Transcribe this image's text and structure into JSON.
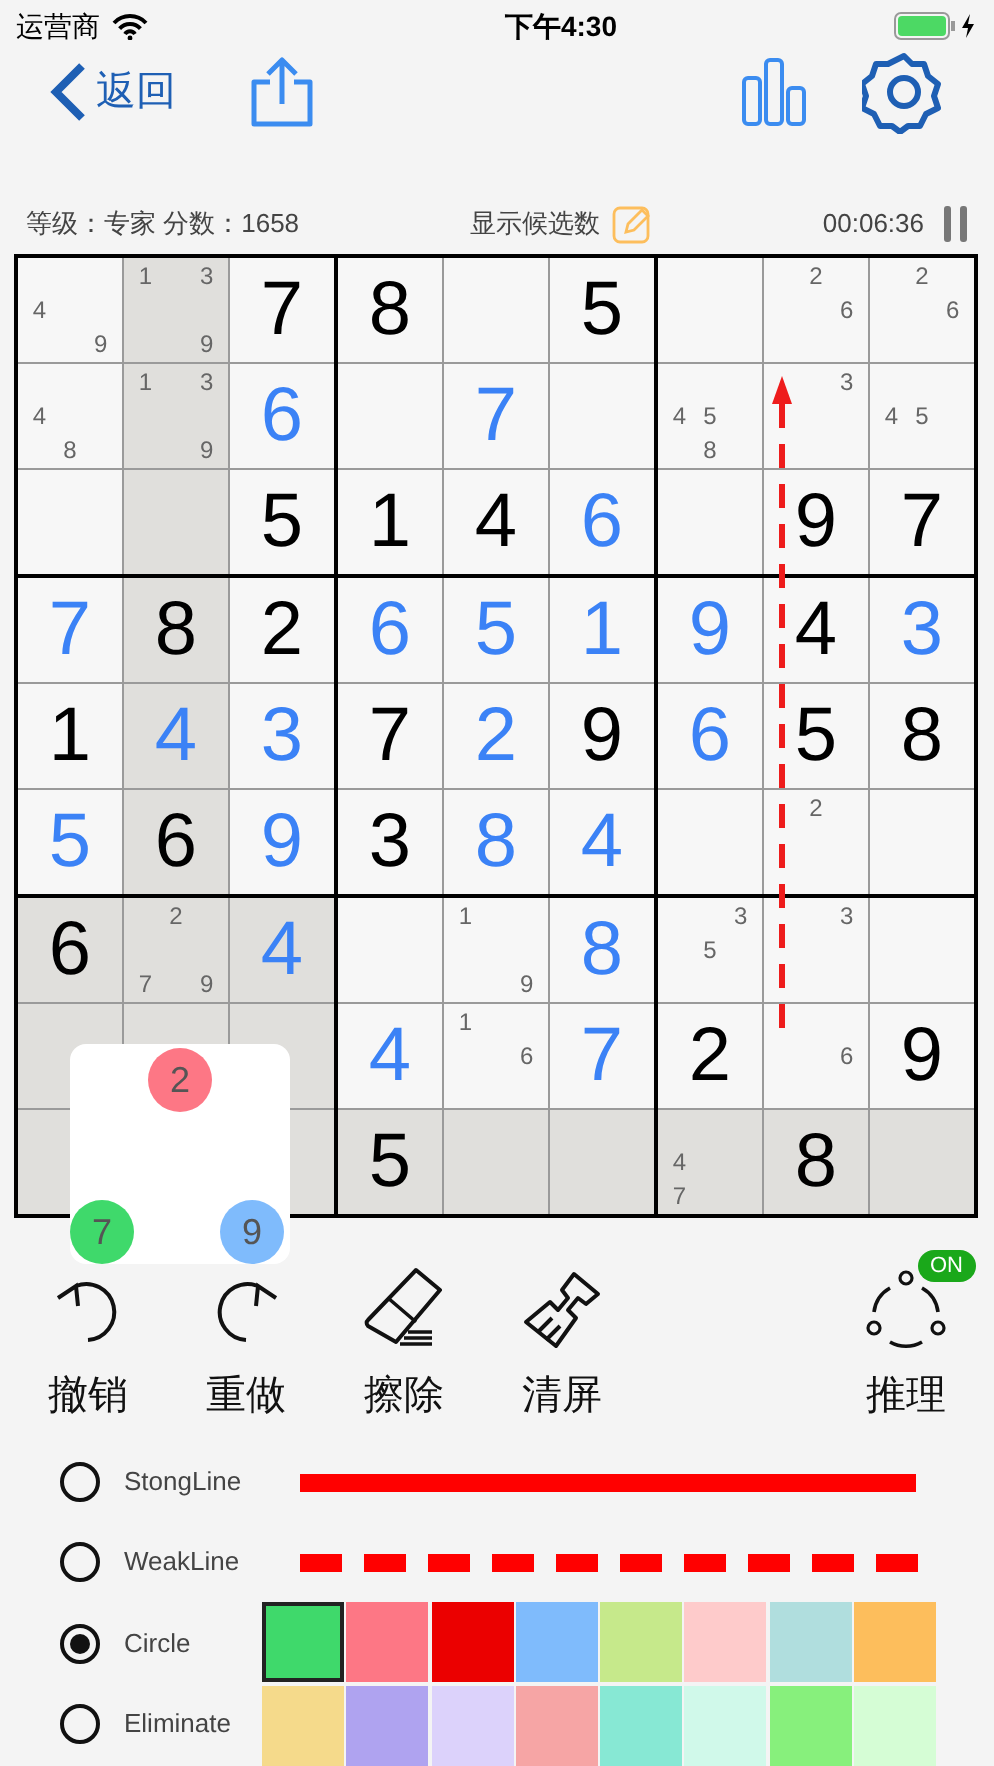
{
  "status_bar": {
    "carrier": "运营商",
    "time": "下午4:30"
  },
  "nav": {
    "back": "返回"
  },
  "info": {
    "level_score": "等级：专家 分数：1658",
    "show_candidates": "显示候选数",
    "timer": "00:06:36"
  },
  "grid": {
    "rows": [
      [
        {
          "candidates": [
            "4",
            "9"
          ],
          "highlighted": false
        },
        {
          "candidates": [
            "1",
            "3",
            "9"
          ],
          "highlighted": true
        },
        {
          "value": "7",
          "given": true,
          "highlighted": false
        },
        {
          "value": "8",
          "given": true,
          "highlighted": false
        },
        {
          "highlighted": false
        },
        {
          "value": "5",
          "given": true,
          "highlighted": false
        },
        {
          "highlighted": false
        },
        {
          "candidates": [
            "2",
            "6"
          ],
          "highlighted": false
        },
        {
          "candidates": [
            "2",
            "6"
          ],
          "highlighted": false
        }
      ],
      [
        {
          "candidates": [
            "4",
            "8"
          ],
          "highlighted": false
        },
        {
          "candidates": [
            "1",
            "3",
            "9"
          ],
          "highlighted": true
        },
        {
          "value": "6",
          "given": false,
          "highlighted": false
        },
        {
          "highlighted": false
        },
        {
          "value": "7",
          "given": false,
          "highlighted": false
        },
        {
          "highlighted": false
        },
        {
          "candidates": [
            "4",
            "5",
            "8"
          ],
          "highlighted": false
        },
        {
          "candidates": [
            "3"
          ],
          "highlighted": false,
          "arrow_to": true
        },
        {
          "candidates": [
            "4",
            "5"
          ],
          "highlighted": false
        }
      ],
      [
        {
          "highlighted": false
        },
        {
          "highlighted": true
        },
        {
          "value": "5",
          "given": true,
          "highlighted": false
        },
        {
          "value": "1",
          "given": true,
          "highlighted": false
        },
        {
          "value": "4",
          "given": true,
          "highlighted": false
        },
        {
          "value": "6",
          "given": false,
          "highlighted": false
        },
        {
          "highlighted": false
        },
        {
          "value": "9",
          "given": true,
          "highlighted": false
        },
        {
          "value": "7",
          "given": true,
          "highlighted": false
        }
      ],
      [
        {
          "value": "7",
          "given": false,
          "highlighted": false
        },
        {
          "value": "8",
          "given": true,
          "highlighted": true
        },
        {
          "value": "2",
          "given": true,
          "highlighted": false
        },
        {
          "value": "6",
          "given": false,
          "highlighted": false
        },
        {
          "value": "5",
          "given": false,
          "highlighted": false
        },
        {
          "value": "1",
          "given": false,
          "highlighted": false
        },
        {
          "value": "9",
          "given": false,
          "highlighted": false
        },
        {
          "value": "4",
          "given": true,
          "highlighted": false
        },
        {
          "value": "3",
          "given": false,
          "highlighted": false
        }
      ],
      [
        {
          "value": "1",
          "given": true,
          "highlighted": false
        },
        {
          "value": "4",
          "given": false,
          "highlighted": true
        },
        {
          "value": "3",
          "given": false,
          "highlighted": false
        },
        {
          "value": "7",
          "given": true,
          "highlighted": false
        },
        {
          "value": "2",
          "given": false,
          "highlighted": false
        },
        {
          "value": "9",
          "given": true,
          "highlighted": false
        },
        {
          "value": "6",
          "given": false,
          "highlighted": false
        },
        {
          "value": "5",
          "given": true,
          "highlighted": false
        },
        {
          "value": "8",
          "given": true,
          "highlighted": false
        }
      ],
      [
        {
          "value": "5",
          "given": false,
          "highlighted": false
        },
        {
          "value": "6",
          "given": true,
          "highlighted": true
        },
        {
          "value": "9",
          "given": false,
          "highlighted": false
        },
        {
          "value": "3",
          "given": true,
          "highlighted": false
        },
        {
          "value": "8",
          "given": false,
          "highlighted": false
        },
        {
          "value": "4",
          "given": false,
          "highlighted": false
        },
        {
          "highlighted": false
        },
        {
          "candidates": [
            "2"
          ],
          "highlighted": false
        },
        {
          "highlighted": false
        }
      ],
      [
        {
          "value": "6",
          "given": true,
          "highlighted": true
        },
        {
          "candidates": [
            "2",
            "7",
            "9"
          ],
          "highlighted": true
        },
        {
          "value": "4",
          "given": false,
          "highlighted": true
        },
        {
          "highlighted": false
        },
        {
          "candidates": [
            "1",
            "9"
          ],
          "highlighted": false
        },
        {
          "value": "8",
          "given": false,
          "highlighted": false
        },
        {
          "candidates": [
            "3",
            "5"
          ],
          "highlighted": false
        },
        {
          "candidates": [
            "3"
          ],
          "highlighted": false
        },
        {
          "highlighted": false
        }
      ],
      [
        {
          "highlighted": true
        },
        {
          "highlighted": true
        },
        {
          "highlighted": true
        },
        {
          "value": "4",
          "given": false,
          "highlighted": false
        },
        {
          "candidates": [
            "1",
            "6"
          ],
          "highlighted": false
        },
        {
          "value": "7",
          "given": false,
          "highlighted": false
        },
        {
          "value": "2",
          "given": true,
          "highlighted": false
        },
        {
          "candidates": [
            "6"
          ],
          "highlighted": false,
          "arrow_from": true
        },
        {
          "value": "9",
          "given": true,
          "highlighted": false
        }
      ],
      [
        {
          "highlighted": true
        },
        {},
        {
          "highlighted": true
        },
        {
          "value": "5",
          "given": true,
          "highlighted": true
        },
        {
          "highlighted": true
        },
        {
          "highlighted": true
        },
        {
          "candidates": [
            "4",
            "7"
          ],
          "highlighted": true
        },
        {
          "value": "8",
          "given": true,
          "highlighted": true
        },
        {
          "highlighted": true
        }
      ]
    ],
    "arrow_dashed": true
  },
  "candidate_popup": {
    "circles": [
      {
        "digit": "2",
        "color": "#fd7785"
      },
      {
        "digit": "7",
        "color": "#3fd96b"
      },
      {
        "digit": "9",
        "color": "#7fbbfc"
      }
    ]
  },
  "toolbar": [
    {
      "kind": "undo",
      "label": "撤销"
    },
    {
      "kind": "redo",
      "label": "重做"
    },
    {
      "kind": "erase",
      "label": "擦除"
    },
    {
      "kind": "clear",
      "label": "清屏"
    },
    {
      "kind": "reasoning",
      "label": "推理",
      "badge": "ON",
      "on": true
    }
  ],
  "modes": [
    {
      "kind": "strong_line",
      "label": "StongLine",
      "selected": false
    },
    {
      "kind": "weak_line",
      "label": "WeakLine",
      "selected": false
    },
    {
      "kind": "circle",
      "label": "Circle",
      "selected": true
    },
    {
      "kind": "eliminate",
      "label": "Eliminate",
      "selected": false
    }
  ],
  "palette": [
    {
      "color": "#3fd96b",
      "selected": true
    },
    {
      "color": "#fd7785",
      "selected": false
    },
    {
      "color": "#eb0000",
      "selected": false
    },
    {
      "color": "#7fbbfc",
      "selected": false
    },
    {
      "color": "#c6e98b",
      "selected": false
    },
    {
      "color": "#fecbcb",
      "selected": false
    },
    {
      "color": "#b0dede",
      "selected": false
    },
    {
      "color": "#fdbe5c",
      "selected": false
    },
    {
      "color": "#f5da8b",
      "selected": false
    },
    {
      "color": "#afa3f0",
      "selected": false
    },
    {
      "color": "#dcd2fb",
      "selected": false
    },
    {
      "color": "#f6a5a5",
      "selected": false
    },
    {
      "color": "#87e8d4",
      "selected": false
    },
    {
      "color": "#d0f9ea",
      "selected": false
    },
    {
      "color": "#87f07c",
      "selected": false
    },
    {
      "color": "#d5fdd5",
      "selected": false
    }
  ]
}
